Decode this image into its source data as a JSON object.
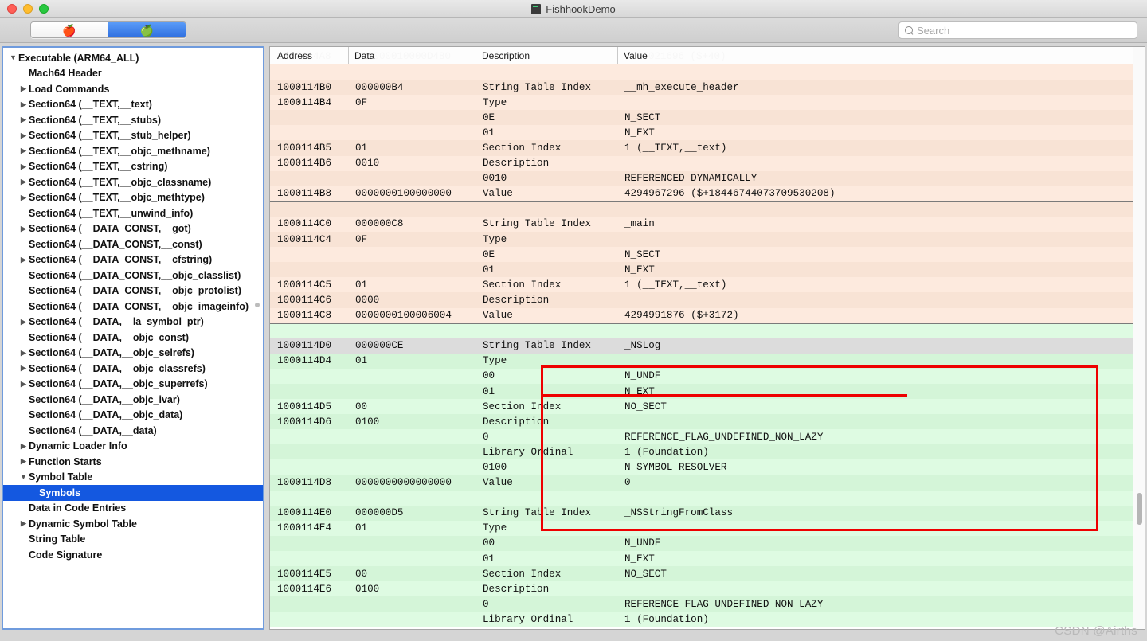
{
  "window": {
    "title": "FishhookDemo",
    "traffic_lights": [
      "close",
      "minimize",
      "maximize"
    ]
  },
  "toolbar": {
    "segments": [
      {
        "icon": "red-apple-icon",
        "glyph": "🍎",
        "selected": false
      },
      {
        "icon": "gray-apple-icon",
        "glyph": "🍏",
        "selected": true
      }
    ],
    "search": {
      "placeholder": "Search",
      "value": "",
      "icon": "search-icon"
    }
  },
  "sidebar": {
    "items": [
      {
        "label": "Executable  (ARM64_ALL)",
        "indent": 0,
        "twist": "▼",
        "selected": false
      },
      {
        "label": "Mach64 Header",
        "indent": 1,
        "twist": "",
        "selected": false
      },
      {
        "label": "Load Commands",
        "indent": 1,
        "twist": "▶",
        "selected": false
      },
      {
        "label": "Section64 (__TEXT,__text)",
        "indent": 1,
        "twist": "▶",
        "selected": false
      },
      {
        "label": "Section64 (__TEXT,__stubs)",
        "indent": 1,
        "twist": "▶",
        "selected": false
      },
      {
        "label": "Section64 (__TEXT,__stub_helper)",
        "indent": 1,
        "twist": "▶",
        "selected": false
      },
      {
        "label": "Section64 (__TEXT,__objc_methname)",
        "indent": 1,
        "twist": "▶",
        "selected": false
      },
      {
        "label": "Section64 (__TEXT,__cstring)",
        "indent": 1,
        "twist": "▶",
        "selected": false
      },
      {
        "label": "Section64 (__TEXT,__objc_classname)",
        "indent": 1,
        "twist": "▶",
        "selected": false
      },
      {
        "label": "Section64 (__TEXT,__objc_methtype)",
        "indent": 1,
        "twist": "▶",
        "selected": false
      },
      {
        "label": "Section64 (__TEXT,__unwind_info)",
        "indent": 1,
        "twist": "",
        "selected": false
      },
      {
        "label": "Section64 (__DATA_CONST,__got)",
        "indent": 1,
        "twist": "▶",
        "selected": false
      },
      {
        "label": "Section64 (__DATA_CONST,__const)",
        "indent": 1,
        "twist": "",
        "selected": false
      },
      {
        "label": "Section64 (__DATA_CONST,__cfstring)",
        "indent": 1,
        "twist": "▶",
        "selected": false
      },
      {
        "label": "Section64 (__DATA_CONST,__objc_classlist)",
        "indent": 1,
        "twist": "",
        "selected": false
      },
      {
        "label": "Section64 (__DATA_CONST,__objc_protolist)",
        "indent": 1,
        "twist": "",
        "selected": false
      },
      {
        "label": "Section64 (__DATA_CONST,__objc_imageinfo)",
        "indent": 1,
        "twist": "",
        "selected": false
      },
      {
        "label": "Section64 (__DATA,__la_symbol_ptr)",
        "indent": 1,
        "twist": "▶",
        "selected": false
      },
      {
        "label": "Section64 (__DATA,__objc_const)",
        "indent": 1,
        "twist": "",
        "selected": false
      },
      {
        "label": "Section64 (__DATA,__objc_selrefs)",
        "indent": 1,
        "twist": "▶",
        "selected": false
      },
      {
        "label": "Section64 (__DATA,__objc_classrefs)",
        "indent": 1,
        "twist": "▶",
        "selected": false
      },
      {
        "label": "Section64 (__DATA,__objc_superrefs)",
        "indent": 1,
        "twist": "▶",
        "selected": false
      },
      {
        "label": "Section64 (__DATA,__objc_ivar)",
        "indent": 1,
        "twist": "",
        "selected": false
      },
      {
        "label": "Section64 (__DATA,__objc_data)",
        "indent": 1,
        "twist": "",
        "selected": false
      },
      {
        "label": "Section64 (__DATA,__data)",
        "indent": 1,
        "twist": "",
        "selected": false
      },
      {
        "label": "Dynamic Loader Info",
        "indent": 1,
        "twist": "▶",
        "selected": false
      },
      {
        "label": "Function Starts",
        "indent": 1,
        "twist": "▶",
        "selected": false
      },
      {
        "label": "Symbol Table",
        "indent": 1,
        "twist": "▼",
        "selected": false
      },
      {
        "label": "Symbols",
        "indent": 2,
        "twist": "",
        "selected": true
      },
      {
        "label": "Data in Code Entries",
        "indent": 1,
        "twist": "",
        "selected": false
      },
      {
        "label": "Dynamic Symbol Table",
        "indent": 1,
        "twist": "▶",
        "selected": false
      },
      {
        "label": "String Table",
        "indent": 1,
        "twist": "",
        "selected": false
      },
      {
        "label": "Code Signature",
        "indent": 1,
        "twist": "",
        "selected": false
      }
    ]
  },
  "table": {
    "columns": [
      "Address",
      "Data",
      "Description",
      "Value"
    ],
    "ghost_row": [
      "1000114A8",
      "000000010000D480",
      "Value",
      "4295021696 ($+40)"
    ],
    "rows": [
      {
        "address": "",
        "data": "",
        "description": "",
        "value": "",
        "tone": "peach",
        "sep": false
      },
      {
        "address": "1000114B0",
        "data": "000000B4",
        "description": "String Table Index",
        "value": "__mh_execute_header",
        "tone": "peach",
        "sep": false
      },
      {
        "address": "1000114B4",
        "data": "0F",
        "description": "Type",
        "value": "",
        "tone": "peach",
        "sep": false
      },
      {
        "address": "",
        "data": "",
        "description": "0E",
        "value": "N_SECT",
        "tone": "peach",
        "sep": false
      },
      {
        "address": "",
        "data": "",
        "description": "01",
        "value": "N_EXT",
        "tone": "peach",
        "sep": false
      },
      {
        "address": "1000114B5",
        "data": "01",
        "description": "Section Index",
        "value": "1 (__TEXT,__text)",
        "tone": "peach",
        "sep": false
      },
      {
        "address": "1000114B6",
        "data": "0010",
        "description": "Description",
        "value": "",
        "tone": "peach",
        "sep": false
      },
      {
        "address": "",
        "data": "",
        "description": "0010",
        "value": "REFERENCED_DYNAMICALLY",
        "tone": "peach",
        "sep": false
      },
      {
        "address": "1000114B8",
        "data": "0000000100000000",
        "description": "Value",
        "value": "4294967296 ($+18446744073709530208)",
        "tone": "peach",
        "sep": false
      },
      {
        "address": "",
        "data": "",
        "description": "",
        "value": "",
        "tone": "peach",
        "sep": true
      },
      {
        "address": "1000114C0",
        "data": "000000C8",
        "description": "String Table Index",
        "value": "_main",
        "tone": "peach",
        "sep": false
      },
      {
        "address": "1000114C4",
        "data": "0F",
        "description": "Type",
        "value": "",
        "tone": "peach",
        "sep": false
      },
      {
        "address": "",
        "data": "",
        "description": "0E",
        "value": "N_SECT",
        "tone": "peach",
        "sep": false
      },
      {
        "address": "",
        "data": "",
        "description": "01",
        "value": "N_EXT",
        "tone": "peach",
        "sep": false
      },
      {
        "address": "1000114C5",
        "data": "01",
        "description": "Section Index",
        "value": "1 (__TEXT,__text)",
        "tone": "peach",
        "sep": false
      },
      {
        "address": "1000114C6",
        "data": "0000",
        "description": "Description",
        "value": "",
        "tone": "peach",
        "sep": false
      },
      {
        "address": "1000114C8",
        "data": "0000000100006004",
        "description": "Value",
        "value": "4294991876 ($+3172)",
        "tone": "peach",
        "sep": false
      },
      {
        "address": "",
        "data": "",
        "description": "",
        "value": "",
        "tone": "green",
        "sep": true
      },
      {
        "address": "1000114D0",
        "data": "000000CE",
        "description": "String Table Index",
        "value": "_NSLog",
        "tone": "selected",
        "sep": false
      },
      {
        "address": "1000114D4",
        "data": "01",
        "description": "Type",
        "value": "",
        "tone": "green",
        "sep": false
      },
      {
        "address": "",
        "data": "",
        "description": "00",
        "value": "N_UNDF",
        "tone": "green",
        "sep": false
      },
      {
        "address": "",
        "data": "",
        "description": "01",
        "value": "N_EXT",
        "tone": "green",
        "sep": false
      },
      {
        "address": "1000114D5",
        "data": "00",
        "description": "Section Index",
        "value": "NO_SECT",
        "tone": "green",
        "sep": false
      },
      {
        "address": "1000114D6",
        "data": "0100",
        "description": "Description",
        "value": "",
        "tone": "green",
        "sep": false
      },
      {
        "address": "",
        "data": "",
        "description": "0",
        "value": "REFERENCE_FLAG_UNDEFINED_NON_LAZY",
        "tone": "green",
        "sep": false
      },
      {
        "address": "",
        "data": "",
        "description": "Library Ordinal",
        "value": "1 (Foundation)",
        "tone": "green",
        "sep": false
      },
      {
        "address": "",
        "data": "",
        "description": "0100",
        "value": "N_SYMBOL_RESOLVER",
        "tone": "green",
        "sep": false
      },
      {
        "address": "1000114D8",
        "data": "0000000000000000",
        "description": "Value",
        "value": "0",
        "tone": "green",
        "sep": false
      },
      {
        "address": "",
        "data": "",
        "description": "",
        "value": "",
        "tone": "green",
        "sep": true
      },
      {
        "address": "1000114E0",
        "data": "000000D5",
        "description": "String Table Index",
        "value": "_NSStringFromClass",
        "tone": "green",
        "sep": false
      },
      {
        "address": "1000114E4",
        "data": "01",
        "description": "Type",
        "value": "",
        "tone": "green",
        "sep": false
      },
      {
        "address": "",
        "data": "",
        "description": "00",
        "value": "N_UNDF",
        "tone": "green",
        "sep": false
      },
      {
        "address": "",
        "data": "",
        "description": "01",
        "value": "N_EXT",
        "tone": "green",
        "sep": false
      },
      {
        "address": "1000114E5",
        "data": "00",
        "description": "Section Index",
        "value": "NO_SECT",
        "tone": "green",
        "sep": false
      },
      {
        "address": "1000114E6",
        "data": "0100",
        "description": "Description",
        "value": "",
        "tone": "green",
        "sep": false
      },
      {
        "address": "",
        "data": "",
        "description": "0",
        "value": "REFERENCE_FLAG_UNDEFINED_NON_LAZY",
        "tone": "green",
        "sep": false
      },
      {
        "address": "",
        "data": "",
        "description": "Library Ordinal",
        "value": "1 (Foundation)",
        "tone": "green",
        "sep": false
      }
    ]
  },
  "annotations": {
    "highlight_box_color": "#ee0000",
    "underline_color": "#ee0000"
  },
  "watermark": {
    "text": "CSDN @Airths"
  }
}
